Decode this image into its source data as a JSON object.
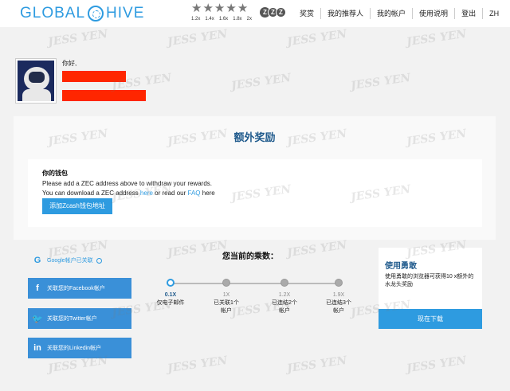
{
  "header": {
    "logo_left": "GLOBAL",
    "logo_right": "HIVE",
    "multipliers": [
      "1.2x",
      "1.4x",
      "1.6x",
      "1.8x",
      "2x"
    ],
    "coin_label": "Z",
    "nav": [
      {
        "label": "奖赏"
      },
      {
        "label": "我的推荐人"
      },
      {
        "label": "我的帐户"
      },
      {
        "label": "使用说明"
      },
      {
        "label": "登出"
      },
      {
        "label": "ZH"
      }
    ]
  },
  "profile": {
    "greeting": "你好,"
  },
  "rewards": {
    "title": "额外奖励",
    "wallet": {
      "title": "你的钱包",
      "line1": "Please add a ZEC address above to withdraw your rewards.",
      "line2_prefix": "You can download a ZEC address ",
      "line2_here": "here",
      "line2_middle": " or read our ",
      "line2_faq": "FAQ",
      "line2_suffix": " here",
      "add_button": "添加Zcash钱包地址"
    }
  },
  "bottom": {
    "google_linked": "Google帐户已关联",
    "facebook": "关联您的Facebook帐户",
    "twitter": "关联您的Twitter帐户",
    "linkedin": "关联您的Linkedin帐户",
    "multiplier_title": "您当前的乘数：",
    "steps": [
      {
        "x": "0.1X",
        "label1": "仅电子邮件",
        "label2": ""
      },
      {
        "x": "1X",
        "label1": "已关联1个",
        "label2": "帐户"
      },
      {
        "x": "1.2X",
        "label1": "已连结2个",
        "label2": "帐户"
      },
      {
        "x": "1.9X",
        "label1": "已连结3个",
        "label2": "帐户"
      }
    ],
    "brave": {
      "title": "使用勇敢",
      "desc": "使用勇敢的浏览器可获得10 x额外的水龙头奖励",
      "button": "现在下载"
    }
  },
  "watermark_text": "JESS YEN"
}
